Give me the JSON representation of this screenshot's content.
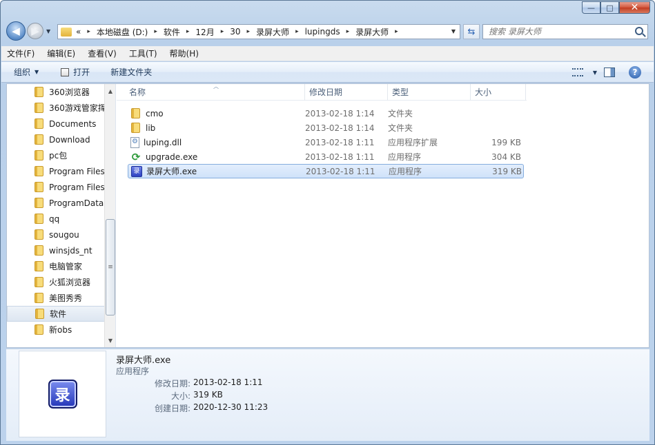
{
  "window": {
    "caption_buttons": {
      "minimize": "—",
      "maximize": "□",
      "close": "✕"
    }
  },
  "address": {
    "overflow": "«",
    "crumbs": [
      "本地磁盘 (D:)",
      "软件",
      "12月",
      "30",
      "录屏大师",
      "lupingds",
      "录屏大师"
    ]
  },
  "search": {
    "placeholder": "搜索 录屏大师"
  },
  "menu": [
    "文件(F)",
    "编辑(E)",
    "查看(V)",
    "工具(T)",
    "帮助(H)"
  ],
  "toolbar": {
    "organize": "组织",
    "open": "打开",
    "new_folder": "新建文件夹"
  },
  "nav": {
    "items": [
      {
        "label": "360浏览器"
      },
      {
        "label": "360游戏管家挥"
      },
      {
        "label": "Documents"
      },
      {
        "label": "Download"
      },
      {
        "label": "pc包"
      },
      {
        "label": "Program Files"
      },
      {
        "label": "Program Files"
      },
      {
        "label": "ProgramData"
      },
      {
        "label": "qq"
      },
      {
        "label": "sougou"
      },
      {
        "label": "winsjds_nt"
      },
      {
        "label": "电脑管家"
      },
      {
        "label": "火狐浏览器"
      },
      {
        "label": "美图秀秀"
      },
      {
        "label": "软件",
        "selected": true
      },
      {
        "label": "新obs"
      }
    ]
  },
  "columns": {
    "name": "名称",
    "date": "修改日期",
    "type": "类型",
    "size": "大小"
  },
  "files": [
    {
      "name": "cmo",
      "date": "2013-02-18 1:14",
      "type": "文件夹",
      "size": "",
      "icon": "folder-icon"
    },
    {
      "name": "lib",
      "date": "2013-02-18 1:14",
      "type": "文件夹",
      "size": "",
      "icon": "folder-icon"
    },
    {
      "name": "luping.dll",
      "date": "2013-02-18 1:11",
      "type": "应用程序扩展",
      "size": "199 KB",
      "icon": "dll-icon"
    },
    {
      "name": "upgrade.exe",
      "date": "2013-02-18 1:11",
      "type": "应用程序",
      "size": "304 KB",
      "icon": "upgrade-icon"
    },
    {
      "name": "录屏大师.exe",
      "date": "2013-02-18 1:11",
      "type": "应用程序",
      "size": "319 KB",
      "icon": "app-icon",
      "selected": true
    }
  ],
  "details": {
    "name": "录屏大师.exe",
    "type": "应用程序",
    "icon_glyph": "录",
    "props": [
      {
        "key": "修改日期:",
        "value": "2013-02-18 1:11"
      },
      {
        "key": "大小:",
        "value": "319 KB"
      },
      {
        "key": "创建日期:",
        "value": "2020-12-30 11:23"
      }
    ]
  }
}
